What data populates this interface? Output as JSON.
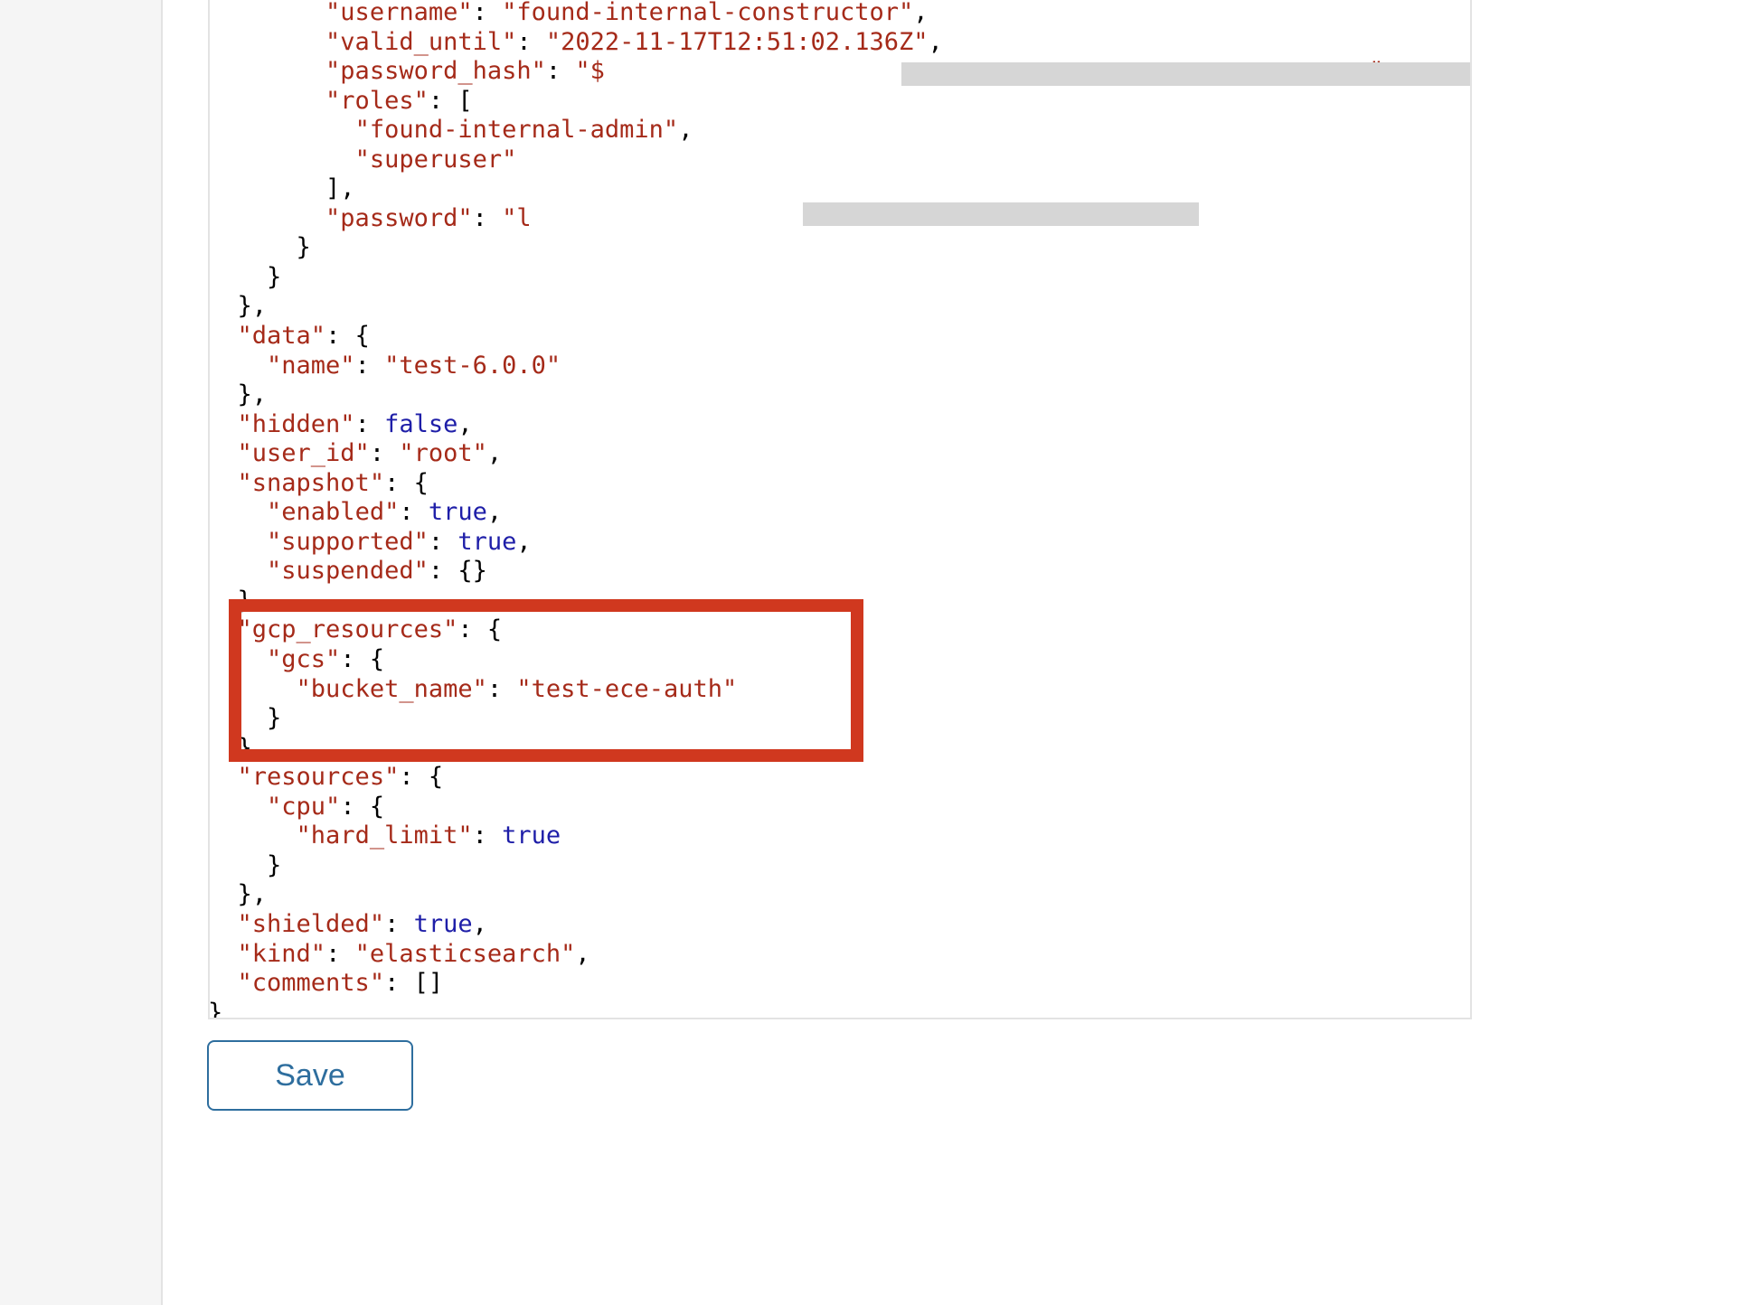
{
  "layout": {
    "sidebar_bg": "#f5f5f5",
    "panel_border": "#e3e3e3",
    "accent_blue": "#2e6e9e",
    "highlight_red": "#d0381f",
    "redaction_gray": "#d6d6d6"
  },
  "json_editor": {
    "label": "cluster-configuration-json",
    "syntax_colors": {
      "string": "#a52a19",
      "key": "#a52a19",
      "boolean": "#1e1ea8",
      "punctuation": "#000000"
    },
    "lines": [
      {
        "indent": 4,
        "segments": [
          {
            "t": "\"username\"",
            "c": "key"
          },
          {
            "t": ": ",
            "c": "punc"
          },
          {
            "t": "\"found-internal-constructor\"",
            "c": "str"
          },
          {
            "t": ",",
            "c": "punc"
          }
        ]
      },
      {
        "indent": 4,
        "segments": [
          {
            "t": "\"valid_until\"",
            "c": "key"
          },
          {
            "t": ": ",
            "c": "punc"
          },
          {
            "t": "\"2022-11-17T12:51:02.136Z\"",
            "c": "str"
          },
          {
            "t": ",",
            "c": "punc"
          }
        ]
      },
      {
        "indent": 4,
        "segments": [
          {
            "t": "\"password_hash\"",
            "c": "key"
          },
          {
            "t": ": ",
            "c": "punc"
          },
          {
            "t": "\"$",
            "c": "str"
          },
          {
            "t": "                                                    ",
            "c": "str"
          },
          {
            "t": "\"",
            "c": "str"
          },
          {
            "t": ",",
            "c": "punc"
          }
        ]
      },
      {
        "indent": 4,
        "segments": [
          {
            "t": "\"roles\"",
            "c": "key"
          },
          {
            "t": ": [",
            "c": "punc"
          }
        ]
      },
      {
        "indent": 5,
        "segments": [
          {
            "t": "\"found-internal-admin\"",
            "c": "str"
          },
          {
            "t": ",",
            "c": "punc"
          }
        ]
      },
      {
        "indent": 5,
        "segments": [
          {
            "t": "\"superuser\"",
            "c": "str"
          }
        ]
      },
      {
        "indent": 4,
        "segments": [
          {
            "t": "],",
            "c": "punc"
          }
        ]
      },
      {
        "indent": 4,
        "segments": [
          {
            "t": "\"password\"",
            "c": "key"
          },
          {
            "t": ": ",
            "c": "punc"
          },
          {
            "t": "\"l",
            "c": "str"
          },
          {
            "t": "                          ",
            "c": "str"
          },
          {
            "t": "\"",
            "c": "str"
          }
        ]
      },
      {
        "indent": 3,
        "segments": [
          {
            "t": "}",
            "c": "punc"
          }
        ]
      },
      {
        "indent": 2,
        "segments": [
          {
            "t": "}",
            "c": "punc"
          }
        ]
      },
      {
        "indent": 1,
        "segments": [
          {
            "t": "},",
            "c": "punc"
          }
        ]
      },
      {
        "indent": 1,
        "segments": [
          {
            "t": "\"data\"",
            "c": "key"
          },
          {
            "t": ": {",
            "c": "punc"
          }
        ]
      },
      {
        "indent": 2,
        "segments": [
          {
            "t": "\"name\"",
            "c": "key"
          },
          {
            "t": ": ",
            "c": "punc"
          },
          {
            "t": "\"test-6.0.0\"",
            "c": "str"
          }
        ]
      },
      {
        "indent": 1,
        "segments": [
          {
            "t": "},",
            "c": "punc"
          }
        ]
      },
      {
        "indent": 1,
        "segments": [
          {
            "t": "\"hidden\"",
            "c": "key"
          },
          {
            "t": ": ",
            "c": "punc"
          },
          {
            "t": "false",
            "c": "bool"
          },
          {
            "t": ",",
            "c": "punc"
          }
        ]
      },
      {
        "indent": 1,
        "segments": [
          {
            "t": "\"user_id\"",
            "c": "key"
          },
          {
            "t": ": ",
            "c": "punc"
          },
          {
            "t": "\"root\"",
            "c": "str"
          },
          {
            "t": ",",
            "c": "punc"
          }
        ]
      },
      {
        "indent": 1,
        "segments": [
          {
            "t": "\"snapshot\"",
            "c": "key"
          },
          {
            "t": ": {",
            "c": "punc"
          }
        ]
      },
      {
        "indent": 2,
        "segments": [
          {
            "t": "\"enabled\"",
            "c": "key"
          },
          {
            "t": ": ",
            "c": "punc"
          },
          {
            "t": "true",
            "c": "bool"
          },
          {
            "t": ",",
            "c": "punc"
          }
        ]
      },
      {
        "indent": 2,
        "segments": [
          {
            "t": "\"supported\"",
            "c": "key"
          },
          {
            "t": ": ",
            "c": "punc"
          },
          {
            "t": "true",
            "c": "bool"
          },
          {
            "t": ",",
            "c": "punc"
          }
        ]
      },
      {
        "indent": 2,
        "segments": [
          {
            "t": "\"suspended\"",
            "c": "key"
          },
          {
            "t": ": {}",
            "c": "punc"
          }
        ]
      },
      {
        "indent": 1,
        "segments": [
          {
            "t": "},",
            "c": "punc"
          }
        ]
      },
      {
        "indent": 1,
        "segments": [
          {
            "t": "\"gcp_resources\"",
            "c": "key"
          },
          {
            "t": ": {",
            "c": "punc"
          }
        ]
      },
      {
        "indent": 2,
        "segments": [
          {
            "t": "\"gcs\"",
            "c": "key"
          },
          {
            "t": ": {",
            "c": "punc"
          }
        ]
      },
      {
        "indent": 3,
        "segments": [
          {
            "t": "\"bucket_name\"",
            "c": "key"
          },
          {
            "t": ": ",
            "c": "punc"
          },
          {
            "t": "\"test-ece-auth\"",
            "c": "str"
          }
        ]
      },
      {
        "indent": 2,
        "segments": [
          {
            "t": "}",
            "c": "punc"
          }
        ]
      },
      {
        "indent": 1,
        "segments": [
          {
            "t": "},",
            "c": "punc"
          }
        ]
      },
      {
        "indent": 1,
        "segments": [
          {
            "t": "\"resources\"",
            "c": "key"
          },
          {
            "t": ": {",
            "c": "punc"
          }
        ]
      },
      {
        "indent": 2,
        "segments": [
          {
            "t": "\"cpu\"",
            "c": "key"
          },
          {
            "t": ": {",
            "c": "punc"
          }
        ]
      },
      {
        "indent": 3,
        "segments": [
          {
            "t": "\"hard_limit\"",
            "c": "key"
          },
          {
            "t": ": ",
            "c": "punc"
          },
          {
            "t": "true",
            "c": "bool"
          }
        ]
      },
      {
        "indent": 2,
        "segments": [
          {
            "t": "}",
            "c": "punc"
          }
        ]
      },
      {
        "indent": 1,
        "segments": [
          {
            "t": "},",
            "c": "punc"
          }
        ]
      },
      {
        "indent": 1,
        "segments": [
          {
            "t": "\"shielded\"",
            "c": "key"
          },
          {
            "t": ": ",
            "c": "punc"
          },
          {
            "t": "true",
            "c": "bool"
          },
          {
            "t": ",",
            "c": "punc"
          }
        ]
      },
      {
        "indent": 1,
        "segments": [
          {
            "t": "\"kind\"",
            "c": "key"
          },
          {
            "t": ": ",
            "c": "punc"
          },
          {
            "t": "\"elasticsearch\"",
            "c": "str"
          },
          {
            "t": ",",
            "c": "punc"
          }
        ]
      },
      {
        "indent": 1,
        "segments": [
          {
            "t": "\"comments\"",
            "c": "key"
          },
          {
            "t": ": []",
            "c": "punc"
          }
        ]
      },
      {
        "indent": 0,
        "segments": [
          {
            "t": "}",
            "c": "punc"
          }
        ]
      }
    ]
  },
  "redactions": [
    {
      "name": "password-hash-redaction",
      "for": "password_hash"
    },
    {
      "name": "password-redaction",
      "for": "password"
    }
  ],
  "highlight": {
    "name": "gcp-resources-highlight",
    "covers": "gcp_resources"
  },
  "actions": {
    "save_label": "Save"
  }
}
